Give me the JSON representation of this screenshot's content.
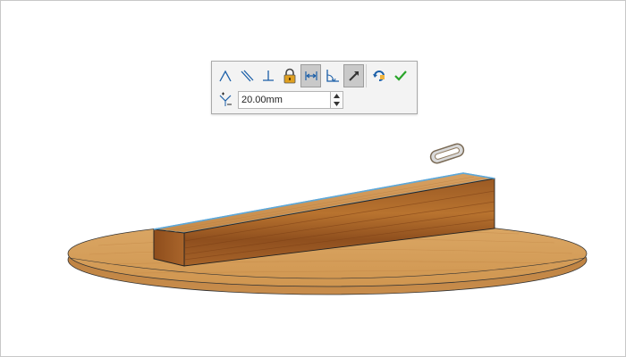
{
  "toolbar": {
    "distance_value": "20.00mm",
    "buttons": [
      {
        "name": "angle-mate-icon",
        "active": false
      },
      {
        "name": "parallel-mate-icon",
        "active": false
      },
      {
        "name": "perpendicular-mate-icon",
        "active": false
      },
      {
        "name": "lock-mate-icon",
        "active": false
      },
      {
        "name": "distance-mate-icon",
        "active": true
      },
      {
        "name": "angle-distance-icon",
        "active": false
      },
      {
        "name": "pin-icon",
        "active": true
      },
      {
        "name": "flip-alignment-icon",
        "active": false
      },
      {
        "name": "accept-checkmark-icon",
        "active": false
      }
    ]
  },
  "colors": {
    "wood_light": "#d49a52",
    "wood_dark": "#8a4a1c",
    "edge_highlight": "#5fa8d8",
    "accept_green": "#2aa52a"
  }
}
